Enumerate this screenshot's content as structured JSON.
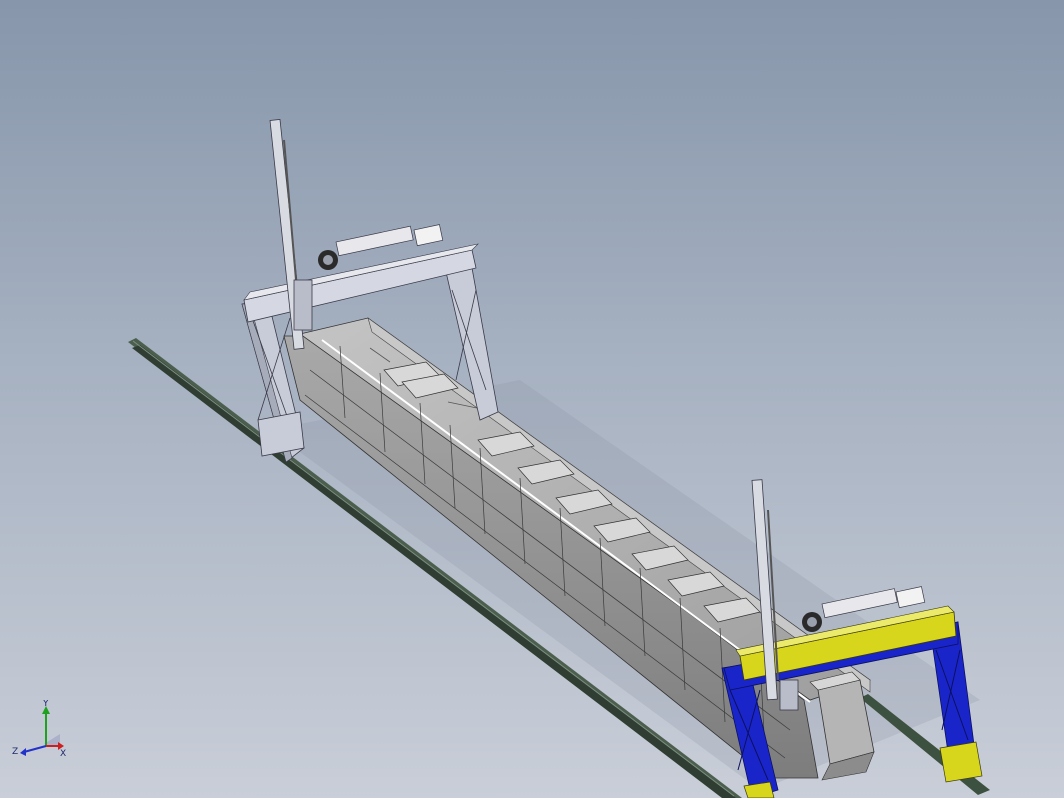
{
  "viewport": {
    "background_top": "#8796ab",
    "background_bottom": "#c9ced8"
  },
  "model": {
    "rail_color": "#3d5140",
    "gantry_rear_color": "#c8ccd8",
    "gantry_front_frame_color": "#1a25c9",
    "gantry_front_beam_color": "#d7d51c",
    "hopper_color": "#9a9a9a"
  },
  "triad": {
    "x_label": "X",
    "y_label": "Y",
    "z_label": "Z",
    "x_color": "#cc2020",
    "y_color": "#1ea11e",
    "z_color": "#2332c8"
  }
}
